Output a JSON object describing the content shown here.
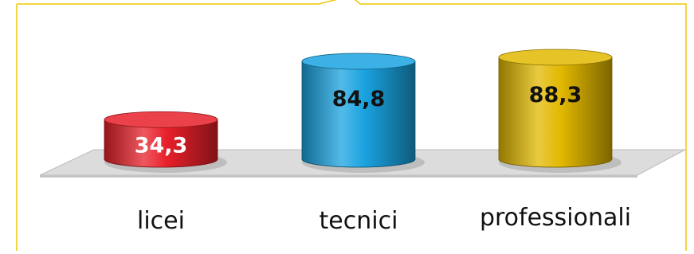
{
  "chart_data": {
    "type": "bar",
    "style": "3d-cylinder",
    "categories": [
      "licei",
      "tecnici",
      "professionali"
    ],
    "values": [
      34.3,
      84.8,
      88.3
    ],
    "value_labels": [
      "34,3",
      "84,8",
      "88,3"
    ],
    "bar_colors": [
      "#e8202a",
      "#1aa3e0",
      "#e2b800"
    ],
    "label_colors": [
      "#ffffff",
      "#111111",
      "#111111"
    ],
    "ylim": [
      0,
      100
    ],
    "grid": false,
    "legend": "none",
    "frame_color": "#f0c800"
  }
}
